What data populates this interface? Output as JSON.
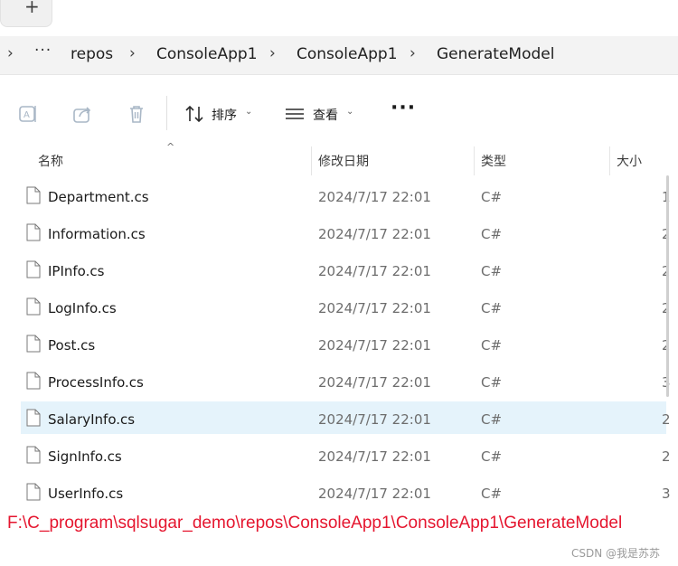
{
  "tabs": {
    "new_tab_label": "+"
  },
  "breadcrumb": {
    "overflow": "···",
    "items": [
      "repos",
      "ConsoleApp1",
      "ConsoleApp1",
      "GenerateModel"
    ]
  },
  "toolbar": {
    "sort_label": "排序",
    "view_label": "查看",
    "more_label": "···"
  },
  "columns": {
    "name": "名称",
    "modified": "修改日期",
    "type": "类型",
    "size": "大小"
  },
  "files": [
    {
      "name": "Department.cs",
      "modified": "2024/7/17 22:01",
      "type": "C#",
      "size": "1"
    },
    {
      "name": "Information.cs",
      "modified": "2024/7/17 22:01",
      "type": "C#",
      "size": "2"
    },
    {
      "name": "IPInfo.cs",
      "modified": "2024/7/17 22:01",
      "type": "C#",
      "size": "2"
    },
    {
      "name": "LogInfo.cs",
      "modified": "2024/7/17 22:01",
      "type": "C#",
      "size": "2"
    },
    {
      "name": "Post.cs",
      "modified": "2024/7/17 22:01",
      "type": "C#",
      "size": "2"
    },
    {
      "name": "ProcessInfo.cs",
      "modified": "2024/7/17 22:01",
      "type": "C#",
      "size": "3"
    },
    {
      "name": "SalaryInfo.cs",
      "modified": "2024/7/17 22:01",
      "type": "C#",
      "size": "2",
      "selected": true
    },
    {
      "name": "SignInfo.cs",
      "modified": "2024/7/17 22:01",
      "type": "C#",
      "size": "2"
    },
    {
      "name": "UserInfo.cs",
      "modified": "2024/7/17 22:01",
      "type": "C#",
      "size": "3"
    }
  ],
  "annotation": {
    "path_text": "F:\\C_program\\sqlsugar_demo\\repos\\ConsoleApp1\\ConsoleApp1\\GenerateModel"
  },
  "watermark": "CSDN @我是苏苏",
  "colors": {
    "selection": "#e5f3fb",
    "annotation": "#e5162f"
  }
}
